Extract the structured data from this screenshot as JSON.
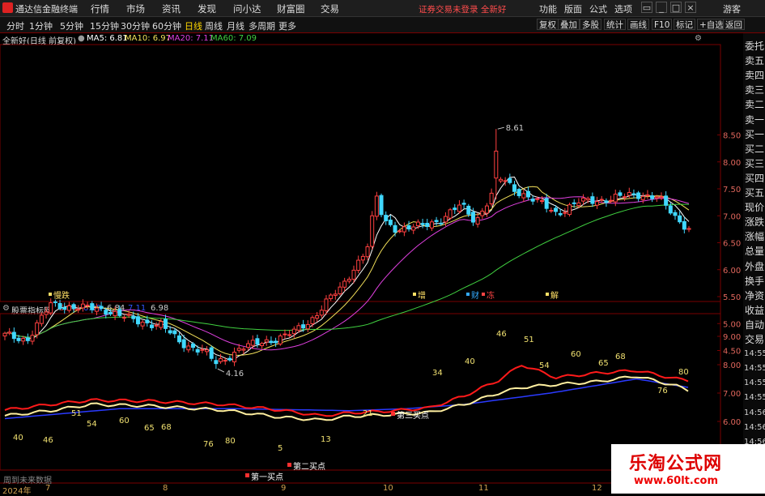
{
  "titlebar": {
    "app_name": "通达信金融终端",
    "menu": [
      "行情",
      "市场",
      "资讯",
      "发现",
      "问小达",
      "财富圈",
      "交易"
    ],
    "status": "证券交易未登录  全新好",
    "right_items": [
      "功能",
      "版面",
      "公式",
      "选项"
    ],
    "window_controls": [
      "▭",
      "_",
      "□",
      "×"
    ],
    "guest": "游客"
  },
  "toolbar": {
    "periods": [
      "分时",
      "1分钟",
      "5分钟",
      "15分钟",
      "30分钟",
      "60分钟",
      "日线",
      "周线",
      "月线",
      "多周期",
      "更多"
    ],
    "active_period": "日线",
    "buttons": [
      "复权",
      "叠加",
      "多股",
      "统计",
      "画线",
      "F10",
      "标记",
      "+自选",
      "返回"
    ]
  },
  "main_chart": {
    "stock_label": "全新好(日线 前复权)",
    "ma": [
      {
        "label": "MA5: 6.81",
        "color": "#ffffff"
      },
      {
        "label": "MA10: 6.97",
        "color": "#f2e05a"
      },
      {
        "label": "MA20: 7.11",
        "color": "#e040e0"
      },
      {
        "label": "MA60: 7.09",
        "color": "#40d040"
      }
    ],
    "y_ticks": [
      "8.50",
      "8.00",
      "7.50",
      "7.00",
      "6.50",
      "6.00",
      "5.50",
      "5.00",
      "4.50"
    ],
    "high_label": "8.61",
    "low_label": "4.16",
    "markers": [
      {
        "text": "慢跌",
        "color": "#ffe066"
      },
      {
        "text": "增",
        "color": "#ffe066"
      },
      {
        "text": "财",
        "color": "#33aaff"
      },
      {
        "text": "冻",
        "color": "#ff4444"
      },
      {
        "text": "解",
        "color": "#ffe066"
      }
    ]
  },
  "sub_chart": {
    "name": "股票指标网",
    "values": [
      {
        "text": "6.98",
        "color": "#ff3333"
      },
      {
        "text": "6.98",
        "color": "#3355ff"
      },
      {
        "text": "6.84",
        "color": "#cccccc"
      },
      {
        "text": "7.11",
        "color": "#3355ff"
      },
      {
        "text": "6.98",
        "color": "#cccccc"
      }
    ],
    "y_ticks": [
      "9.00",
      "8.00",
      "7.00",
      "6.00"
    ],
    "numbers": [
      "40",
      "46",
      "51",
      "54",
      "60",
      "65",
      "68",
      "76",
      "80",
      "5",
      "13",
      "21",
      "34",
      "40",
      "46",
      "51",
      "54",
      "60",
      "65",
      "68",
      "76",
      "80"
    ],
    "signals": [
      "第一买点",
      "第二买点",
      "第三买点"
    ]
  },
  "sidebar": [
    "委托",
    "卖五",
    "卖四",
    "卖三",
    "卖二",
    "卖一",
    "买一",
    "买二",
    "买三",
    "买四",
    "买五",
    "现价",
    "涨跌",
    "涨幅",
    "总量",
    "外盘",
    "换手",
    "净资",
    "收益",
    "自动",
    "交易",
    "14:55",
    "14:55",
    "14:55",
    "14:55",
    "14:56",
    "14:56",
    "14:56"
  ],
  "footer": {
    "future_label": "周到未来数据",
    "dates": [
      "2024年",
      "7",
      "8",
      "9",
      "10",
      "11",
      "12"
    ]
  },
  "watermark": {
    "cn": "乐淘公式网",
    "url": "www.60lt.com"
  }
}
